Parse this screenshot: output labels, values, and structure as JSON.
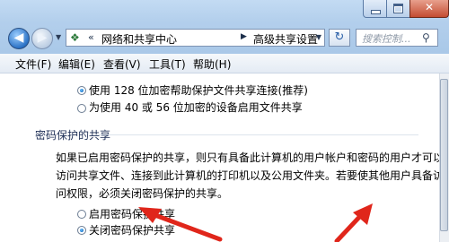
{
  "window": {
    "breadcrumb": [
      "网络和共享中心",
      "高级共享设置"
    ],
    "search_placeholder": "搜索控制...",
    "address_chevron": "«"
  },
  "menu": [
    "文件(F)",
    "编辑(E)",
    "查看(V)",
    "工具(T)",
    "帮助(H)"
  ],
  "encryption_options": [
    {
      "label": "使用 128 位加密帮助保护文件共享连接(推荐)",
      "checked": true
    },
    {
      "label": "为使用 40 或 56 位加密的设备启用文件共享",
      "checked": false
    }
  ],
  "password_section": {
    "heading": "密码保护的共享",
    "description": [
      "如果已启用密码保护的共享，则只有具备此计算机的用户帐户和密码的用户才可以",
      "访问共享文件、连接到此计算机的打印机以及公用文件夹。若要使其他用户具备访",
      "问权限，必须关闭密码保护的共享。"
    ],
    "options": [
      {
        "label": "启用密码保护共享",
        "checked": false
      },
      {
        "label": "关闭密码保护共享",
        "checked": true
      }
    ]
  },
  "colors": {
    "annotation_arrow": "#e0261b",
    "accent": "#1c5ea8"
  }
}
